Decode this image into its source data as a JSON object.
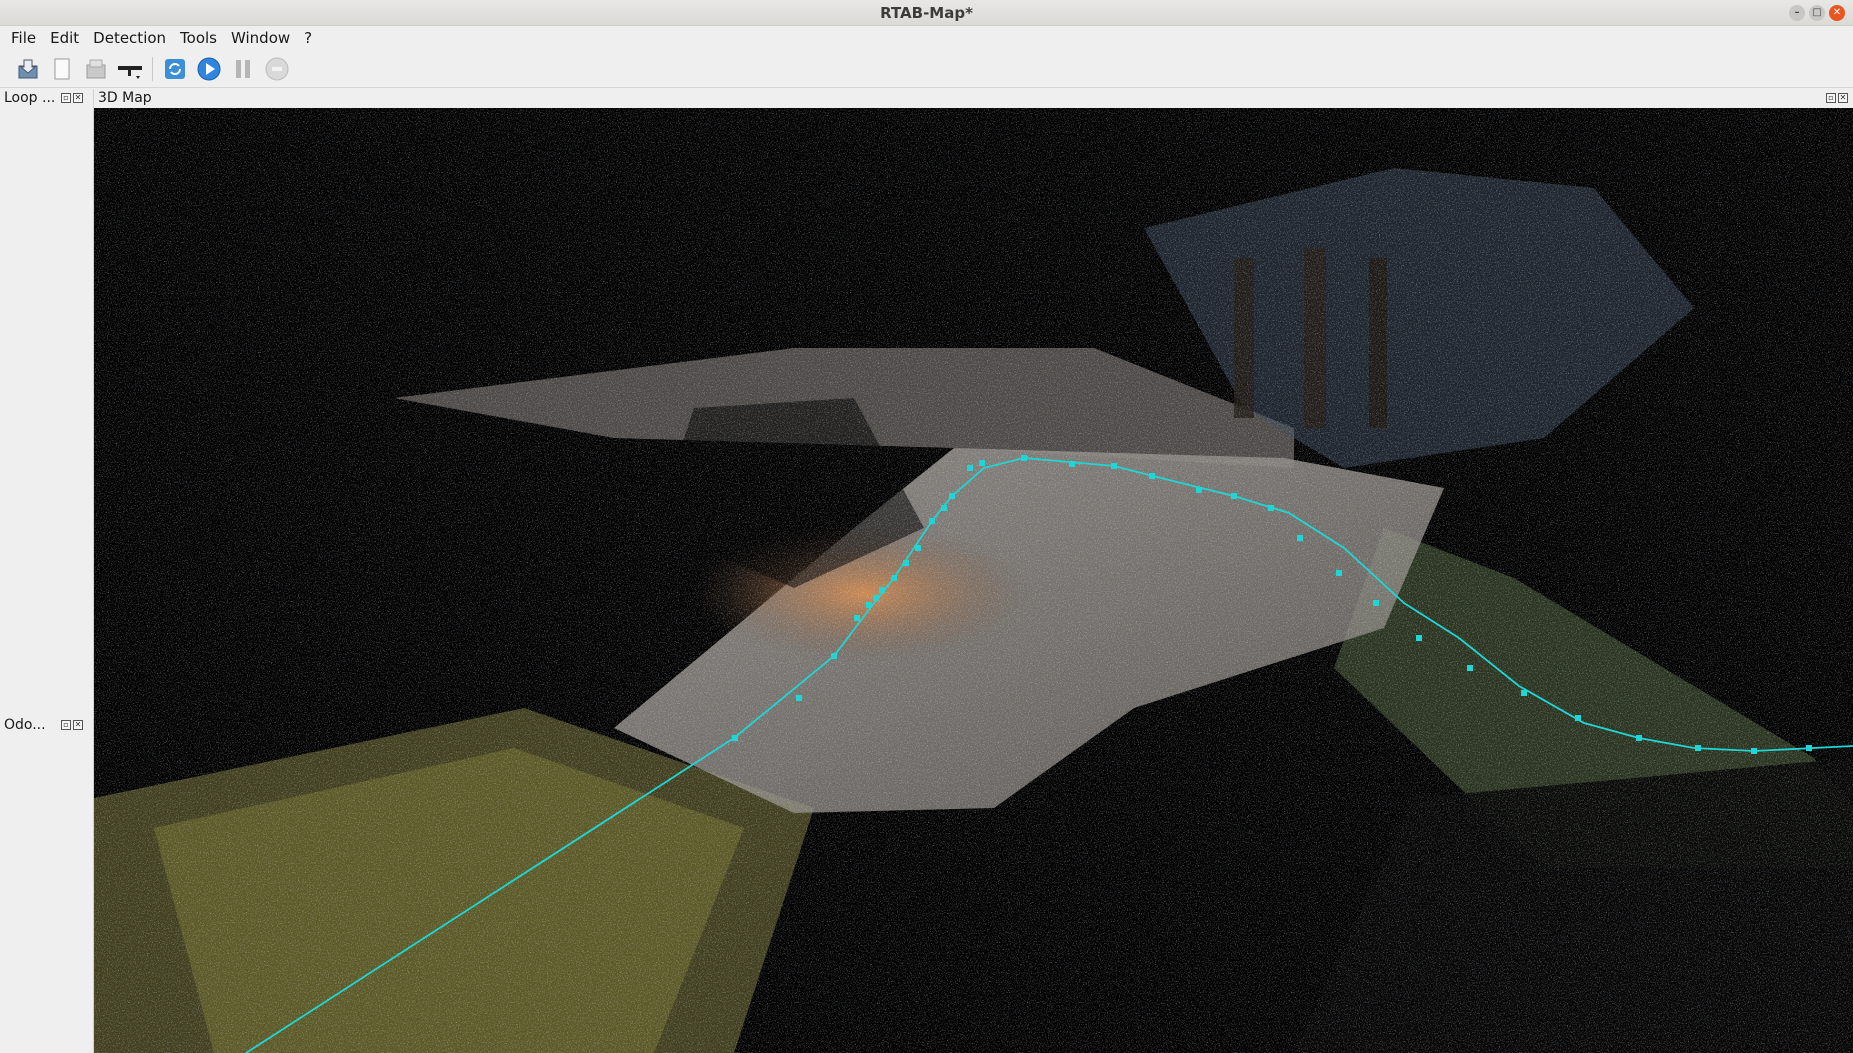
{
  "window": {
    "title": "RTAB-Map*",
    "controls": [
      "minimize",
      "maximize",
      "close"
    ]
  },
  "menu": [
    "File",
    "Edit",
    "Detection",
    "Tools",
    "Window",
    "?"
  ],
  "toolbar": {
    "buttons": [
      {
        "icon": "open-database-icon"
      },
      {
        "icon": "new-database-icon"
      },
      {
        "icon": "close-database-icon"
      },
      {
        "icon": "camera-icon"
      },
      {
        "icon": "refresh-icon"
      },
      {
        "icon": "start-icon"
      },
      {
        "icon": "pause-icon"
      },
      {
        "icon": "stop-icon"
      }
    ]
  },
  "docks": {
    "loop": {
      "title": "Loop ..."
    },
    "odometry": {
      "title": "Odo..."
    },
    "map3d": {
      "title": "3D Map"
    }
  },
  "colors": {
    "trajectory": "#1fd6d6",
    "background": "#000000",
    "accent_close": "#e95420",
    "start_button": "#2e86de"
  }
}
